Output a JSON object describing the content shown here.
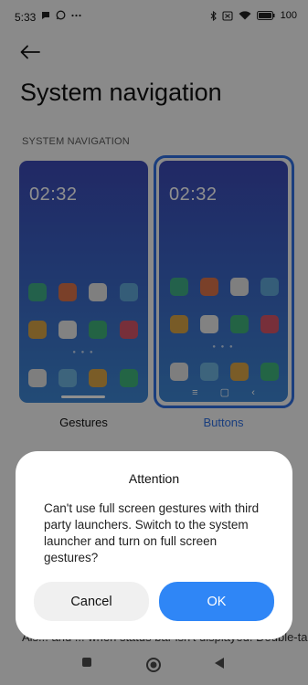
{
  "status_bar": {
    "time": "5:33",
    "left_icons": [
      "chat-bubble-icon",
      "whatsapp-icon",
      "more-icon"
    ],
    "right_icons": [
      "bluetooth-icon",
      "signal-off-icon",
      "wifi-icon",
      "battery-icon"
    ],
    "battery_text": "100"
  },
  "header": {
    "back_icon": "arrow-left-icon",
    "title": "System navigation"
  },
  "section_label": "SYSTEM NAVIGATION",
  "options": [
    {
      "label": "Gestures",
      "clock": "02:32",
      "selected": false
    },
    {
      "label": "Buttons",
      "clock": "02:32",
      "selected": true
    }
  ],
  "colors": {
    "accent": "#2f6fe0",
    "ok_button": "#2f86f6",
    "app_icons": [
      "#3fae86",
      "#d9724a",
      "#e3e3e3",
      "#5fa6d6",
      "#d7a246",
      "#e8e8e8",
      "#3fb07a",
      "#d55468",
      "#e0e0e0",
      "#6eb3dd",
      "#d9a546",
      "#3fb57c"
    ]
  },
  "behind_text": "Als... and ... when status bar isn't displayed. Double-tap",
  "dialog": {
    "title": "Attention",
    "message": "Can't use full screen gestures with third party launchers. Switch to the system launcher and turn on full screen gestures?",
    "cancel_label": "Cancel",
    "ok_label": "OK"
  },
  "system_nav": [
    "recents-square-icon",
    "home-circle-icon",
    "back-triangle-icon"
  ]
}
